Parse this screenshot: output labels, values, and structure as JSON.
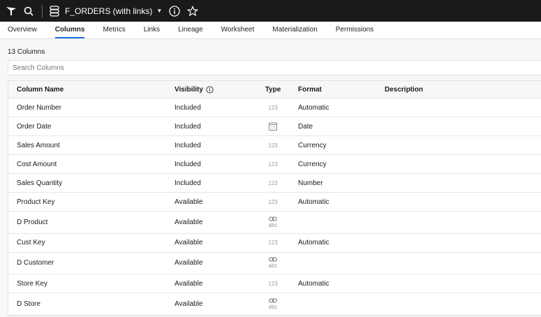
{
  "header": {
    "title": "F_ORDERS (with links)"
  },
  "tabs": [
    "Overview",
    "Columns",
    "Metrics",
    "Links",
    "Lineage",
    "Worksheet",
    "Materialization",
    "Permissions"
  ],
  "active_tab": 1,
  "count_label": "13 Columns",
  "search": {
    "placeholder": "Search Columns"
  },
  "table": {
    "headers": {
      "name": "Column Name",
      "visibility": "Visibility",
      "type": "Type",
      "format": "Format",
      "description": "Description"
    },
    "rows": [
      {
        "name": "Order Number",
        "visibility": "Included",
        "type": "123",
        "format": "Automatic"
      },
      {
        "name": "Order Date",
        "visibility": "Included",
        "type": "calendar",
        "format": "Date"
      },
      {
        "name": "Sales Amount",
        "visibility": "Included",
        "type": "123",
        "format": "Currency"
      },
      {
        "name": "Cost Amount",
        "visibility": "Included",
        "type": "123",
        "format": "Currency"
      },
      {
        "name": "Sales Quantity",
        "visibility": "Included",
        "type": "123",
        "format": "Number"
      },
      {
        "name": "Product Key",
        "visibility": "Available",
        "type": "123",
        "format": "Automatic"
      },
      {
        "name": "D Product",
        "visibility": "Available",
        "type": "abc",
        "format": ""
      },
      {
        "name": "Cust Key",
        "visibility": "Available",
        "type": "123",
        "format": "Automatic"
      },
      {
        "name": "D Customer",
        "visibility": "Available",
        "type": "abc",
        "format": ""
      },
      {
        "name": "Store Key",
        "visibility": "Available",
        "type": "123",
        "format": "Automatic"
      },
      {
        "name": "D Store",
        "visibility": "Available",
        "type": "abc",
        "format": ""
      }
    ]
  }
}
